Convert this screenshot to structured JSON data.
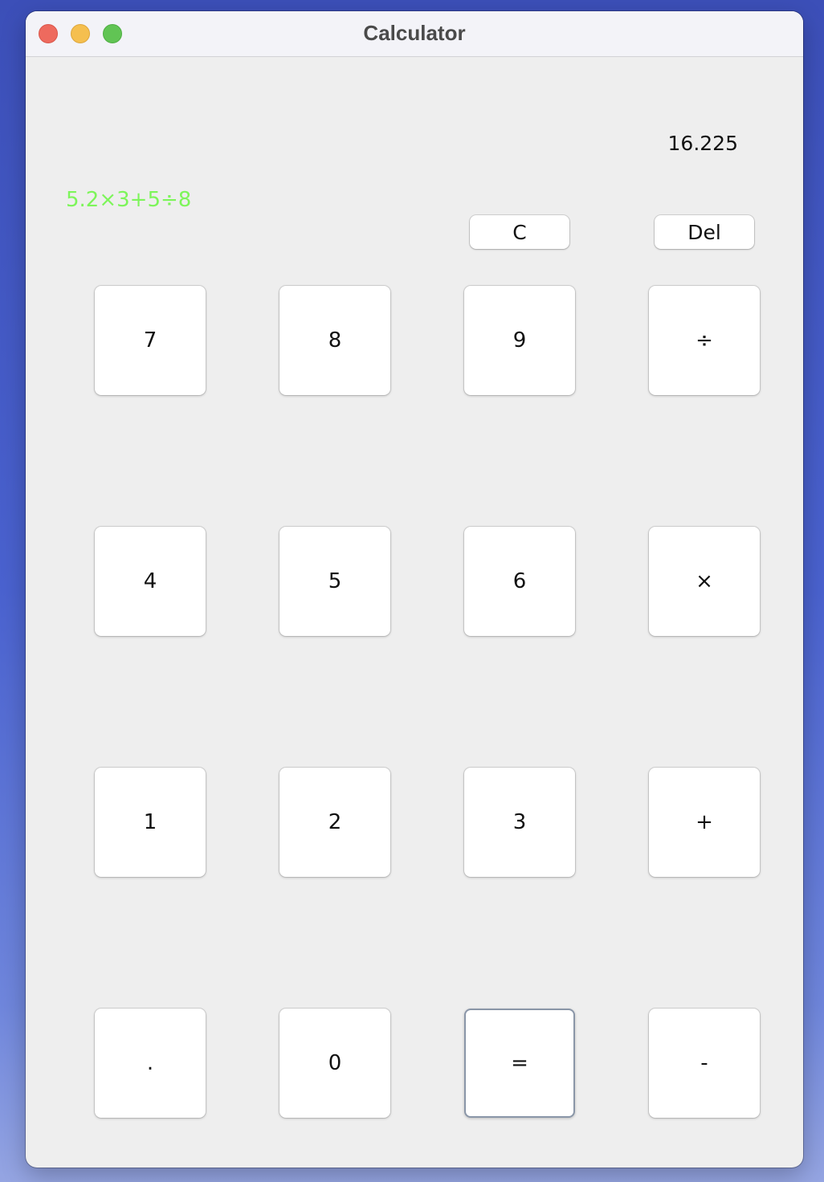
{
  "window": {
    "title": "Calculator"
  },
  "display": {
    "result": "16.225",
    "expression": "5.2×3+5÷8",
    "expression_color": "#7df55a"
  },
  "controls": {
    "clear_label": "C",
    "delete_label": "Del"
  },
  "keypad": {
    "rows": [
      [
        "7",
        "8",
        "9",
        "÷"
      ],
      [
        "4",
        "5",
        "6",
        "×"
      ],
      [
        "1",
        "2",
        "3",
        "+"
      ],
      [
        ".",
        "0",
        "=",
        "-"
      ]
    ],
    "focused_key": "="
  }
}
